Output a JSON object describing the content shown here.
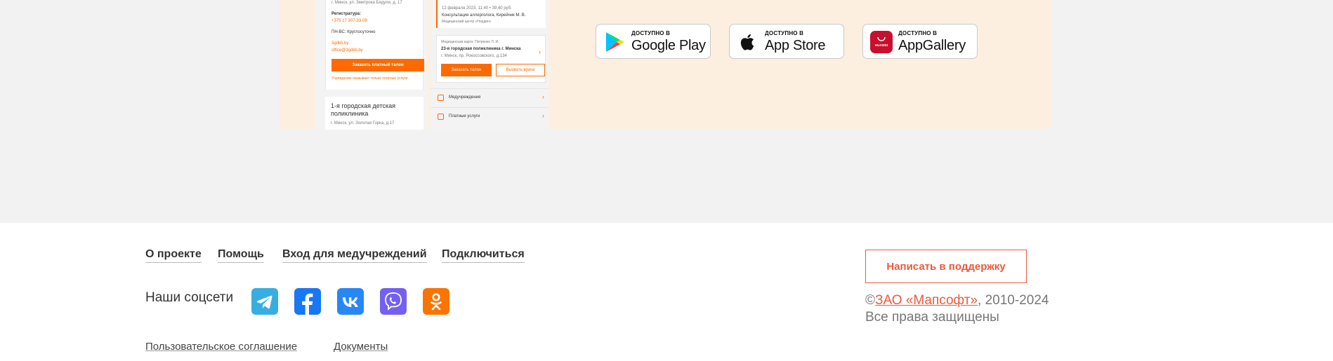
{
  "phone_mockup": {
    "card1": {
      "address": "г. Минск, ул. Змитрока Бядули, д. 17",
      "reception_label": "Регистратура:",
      "phone": "+375 17 307-33-09",
      "hours": "ПН-ВС: Круглосуточно",
      "site": "3gdkb.by",
      "email": "office@3gdkb.by",
      "order_button": "Заказать платный талон",
      "note": "Учреждение оказывает только платные услуги"
    },
    "card2": {
      "title": "1-я городская детская поликлиника",
      "address": "г. Минск, ул. Золотая Горка, д.17"
    },
    "appointment": {
      "date": "12 февраля 2023, 11:40 • 39,40 руб.",
      "service": "Консультация аллерголога, Кирейчик М. В.",
      "center": "Медицинский центр «Нордин»"
    },
    "doctor_card": {
      "caption": "Медицинская карта: Петренко Л. И.",
      "clinic": "23-я городская поликлиника г. Минска",
      "address": "г. Минск, пр. Рокоссовского, д.134",
      "order_button": "Заказать талон",
      "call_button": "Вызвать врача"
    },
    "menu": [
      {
        "label": "Медучреждения"
      },
      {
        "label": "Платные услуги"
      }
    ]
  },
  "stores": [
    {
      "available": "ДОСТУПНО В",
      "name": "Google Play",
      "icon": "google-play-icon"
    },
    {
      "available": "ДОСТУПНО В",
      "name": "App Store",
      "icon": "apple-icon"
    },
    {
      "available": "ДОСТУПНО В",
      "name": "AppGallery",
      "icon": "huawei-icon",
      "icon_text": "HUAWEI"
    }
  ],
  "footer": {
    "nav": [
      {
        "label": "О проекте"
      },
      {
        "label": "Помощь"
      },
      {
        "label": "Вход для медучреждений"
      },
      {
        "label": "Подключиться"
      }
    ],
    "social_label": "Наши соцсети",
    "socials": [
      {
        "name": "telegram-icon",
        "color": "#37aee2"
      },
      {
        "name": "facebook-icon",
        "color": "#1877f2"
      },
      {
        "name": "vk-icon",
        "color": "#2787f5"
      },
      {
        "name": "viber-icon",
        "color": "#7360f2"
      },
      {
        "name": "odnoklassniki-icon",
        "color": "#f97400"
      }
    ],
    "bottom_links": [
      {
        "label": "Пользовательское соглашение"
      },
      {
        "label": "Документы"
      }
    ],
    "support_button": "Написать в поддержку",
    "copyright_symbol": "©",
    "company": "ЗАО «Мапсофт»",
    "years": ", 2010-2024",
    "rights": "Все права защищены"
  },
  "colors": {
    "accent": "#ff6a00",
    "support": "#ee5a3a",
    "promo_bg": "#fdefe0",
    "page_bg": "#f2f2f2"
  }
}
